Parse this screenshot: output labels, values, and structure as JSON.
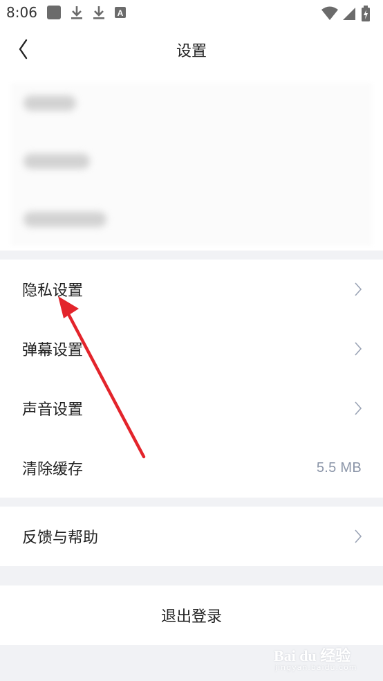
{
  "status_bar": {
    "time": "8:06",
    "icons_left": [
      "square-app-icon",
      "download-icon",
      "download-icon",
      "font-a-icon"
    ],
    "icons_right": [
      "wifi-icon",
      "signal-icon",
      "battery-charging-icon"
    ]
  },
  "header": {
    "title": "设置",
    "back_icon": "chevron-left-icon"
  },
  "sections": [
    {
      "items": [
        {
          "label": "隐私设置",
          "trailing": "chevron"
        },
        {
          "label": "弹幕设置",
          "trailing": "chevron"
        },
        {
          "label": "声音设置",
          "trailing": "chevron"
        },
        {
          "label": "清除缓存",
          "value": "5.5 MB"
        }
      ]
    },
    {
      "items": [
        {
          "label": "反馈与帮助",
          "trailing": "chevron"
        }
      ]
    }
  ],
  "logout": {
    "label": "退出登录"
  },
  "annotation": {
    "color": "#e3242b"
  },
  "watermark": {
    "brand": "Bai du 经验",
    "sub": "jingyan.baidu.com"
  },
  "colors": {
    "background": "#f1f2f5",
    "card": "#ffffff",
    "value_text": "#8b95a8",
    "chevron": "#9aa3b5"
  }
}
